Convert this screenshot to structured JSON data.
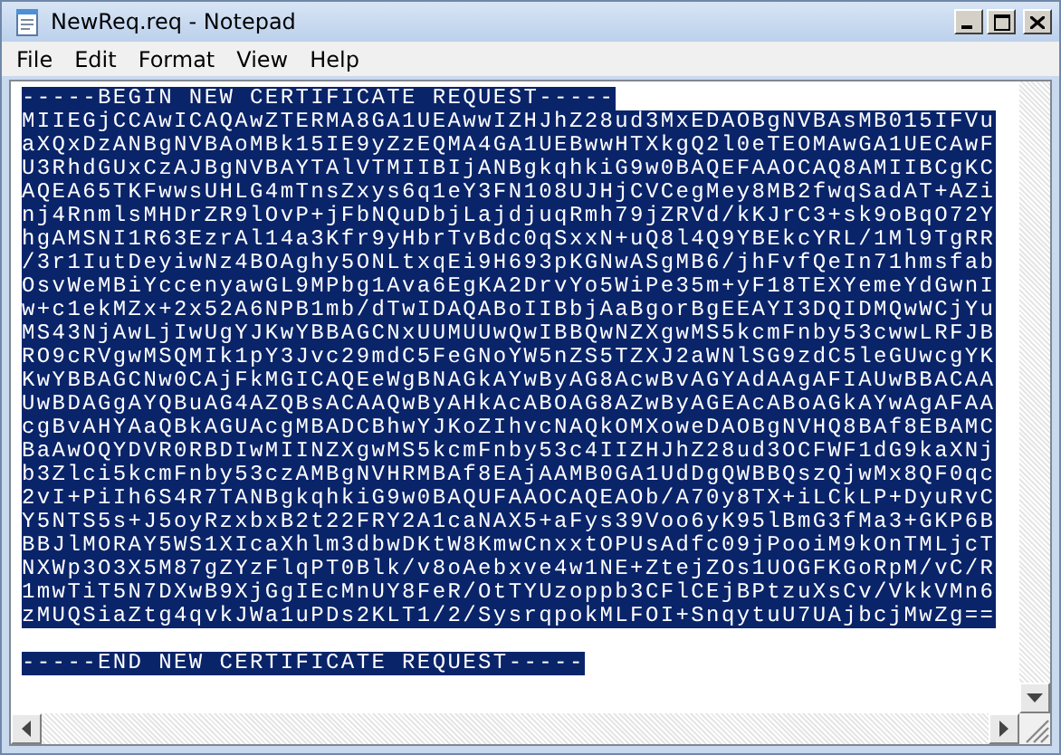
{
  "window": {
    "title": "NewReq.req - Notepad"
  },
  "menu": [
    "File",
    "Edit",
    "Format",
    "View",
    "Help"
  ],
  "document": {
    "selected": true,
    "begin_marker": "-----BEGIN NEW CERTIFICATE REQUEST-----",
    "lines": [
      "MIIEGjCCAwICAQAwZTERMA8GA1UEAwwIZHJhZ28ud3MxEDAOBgNVBAsMB015IFVu",
      "aXQxDzANBgNVBAoMBk15IE9yZzEQMA4GA1UEBwwHTXkgQ2l0eTEOMAwGA1UECAwF",
      "U3RhdGUxCzAJBgNVBAYTAlVTMIIBIjANBgkqhkiG9w0BAQEFAAOCAQ8AMIIBCgKC",
      "AQEA65TKFwwsUHLG4mTnsZxys6q1eY3FN108UJHjCVCegMey8MB2fwqSadAT+AZi",
      "nj4RnmlsMHDrZR9lOvP+jFbNQuDbjLajdjuqRmh79jZRVd/kKJrC3+sk9oBqO72Y",
      "hgAMSNI1R63EzrAl14a3Kfr9yHbrTvBdc0qSxxN+uQ8l4Q9YBEkcYRL/1Ml9TgRR",
      "/3r1IutDeyiwNz4BOAghy5ONLtxqEi9H693pKGNwASgMB6/jhFvfQeIn71hmsfab",
      "OsvWeMBiYccenyawGL9MPbg1Ava6EgKA2DrvYo5WiPe35m+yF18TEXYemeYdGwnI",
      "w+c1ekMZx+2x52A6NPB1mb/dTwIDAQABoIIBbjAaBgorBgEEAYI3DQIDMQwWCjYu",
      "MS43NjAwLjIwUgYJKwYBBAGCNxUUMUUwQwIBBQwNZXgwMS5kcmFnby53cwwLRFJB",
      "RO9cRVgwMSQMIk1pY3Jvc29mdC5FeGNoYW5nZS5TZXJ2aWNlSG9zdC5leGUwcgYK",
      "KwYBBAGCNw0CAjFkMGICAQEeWgBNAGkAYwByAG8AcwBvAGYAdAAgAFIAUwBBACAA",
      "UwBDAGgAYQBuAG4AZQBsACAAQwByAHkAcABOAG8AZwByAGEAcABoAGkAYwAgAFAA",
      "cgBvAHYAaQBkAGUAcgMBADCBhwYJKoZIhvcNAQkOMXoweDAOBgNVHQ8BAf8EBAMC",
      "BaAwOQYDVR0RBDIwMIINZXgwMS5kcmFnby53c4IIZHJhZ28ud3OCFWF1dG9kaXNj",
      "b3Zlci5kcmFnby53czAMBgNVHRMBAf8EAjAAMB0GA1UdDgQWBBQszQjwMx8QF0qc",
      "2vI+PiIh6S4R7TANBgkqhkiG9w0BAQUFAAOCAQEAOb/A70y8TX+iLCkLP+DyuRvC",
      "Y5NTS5s+J5oyRzxbxB2t22FRY2A1caNAX5+aFys39Voo6yK95lBmG3fMa3+GKP6B",
      "BBJlMORAY5WS1XIcaXhlm3dbwDKtW8KmwCnxxtOPUsAdfc09jPooiM9kOnTMLjcT",
      "NXWp3O3X5M87gZYzFlqPT0Blk/v8oAebxve4w1NE+ZtejZOs1UOGFKGoRpM/vC/R",
      "1mwTiT5N7DXwB9XjGgIEcMnUY8FeR/OtTYUzoppb3CFlCEjBPtzuXsCv/VkkVMn6",
      "zMUQSiaZtg4qvkJWa1uPDs2KLT1/2/SysrqpokMLFOI+SnqytuU7UAjbcjMwZg=="
    ],
    "end_marker": "-----END NEW CERTIFICATE REQUEST-----"
  }
}
